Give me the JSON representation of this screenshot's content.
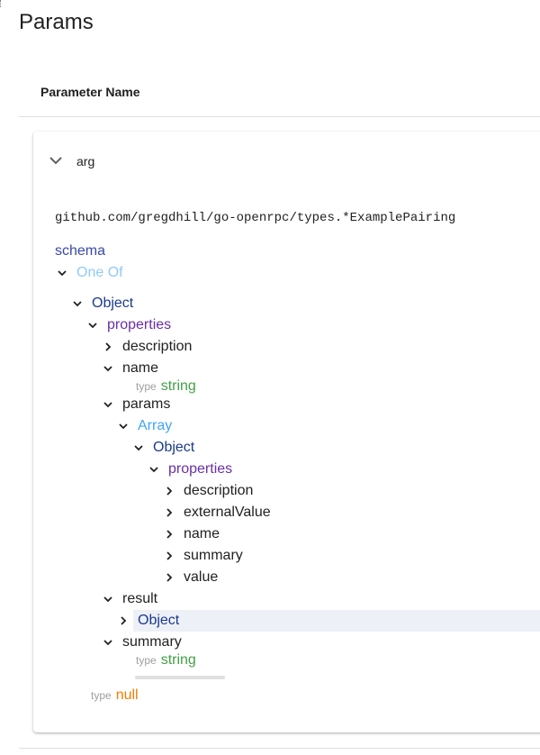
{
  "page": {
    "title": "Params",
    "column_header": "Parameter Name"
  },
  "param": {
    "name": "arg",
    "type_path": "github.com/gregdhill/go-openrpc/types.*ExamplePairing",
    "schema_label": "schema"
  },
  "tree": {
    "one_of": "One Of",
    "object": "Object",
    "properties": "properties",
    "description": "description",
    "name": "name",
    "type_word": "type",
    "string": "string",
    "params": "params",
    "array": "Array",
    "inner_object": "Object",
    "inner_properties": "properties",
    "inner_items": [
      "description",
      "externalValue",
      "name",
      "summary",
      "value"
    ],
    "result": "result",
    "result_object": "Object",
    "summary": "summary",
    "null_type": "null"
  },
  "colors": {
    "object": "#1a3a8c",
    "properties": "#6a2fa8",
    "one_of": "#90caf9",
    "array": "#42a5f5",
    "string": "#43a047",
    "null": "#f57c00",
    "schema": "#3949ab"
  },
  "icons": {
    "expanded": "chevron-down-icon",
    "collapsed": "chevron-right-icon"
  }
}
